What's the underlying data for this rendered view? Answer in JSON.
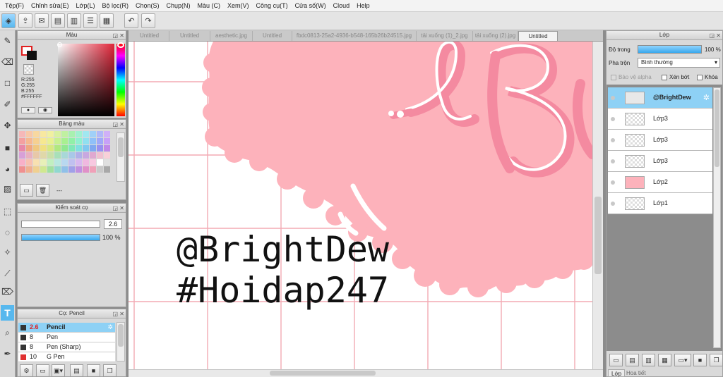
{
  "menu": [
    "Tệp(F)",
    "Chỉnh sửa(E)",
    "Lớp(L)",
    "Bộ lọc(R)",
    "Chọn(S)",
    "Chụp(N)",
    "Màu (C)",
    "Xem(V)",
    "Công cụ(T)",
    "Cửa số(W)",
    "Cloud",
    "Help"
  ],
  "color_panel": {
    "title": "Màu",
    "r": "R:255",
    "g": "G:255",
    "b": "B:255",
    "hex": "#FFFFFF"
  },
  "palette_panel": {
    "title": "Bảng màu",
    "more": "---"
  },
  "brush_control": {
    "title": "Kiểm soát cọ",
    "size_value": "2.6",
    "size_fraction": 0.95,
    "opacity_label": "100 %",
    "opacity_fraction": 1.0
  },
  "brush_panel": {
    "title": "Cọ: Pencil",
    "items": [
      {
        "size": "2.6",
        "name": "Pencil",
        "color": "#333333"
      },
      {
        "size": "8",
        "name": "Pen",
        "color": "#333333"
      },
      {
        "size": "8",
        "name": "Pen (Sharp)",
        "color": "#333333"
      },
      {
        "size": "10",
        "name": "G Pen",
        "color": "#e03030"
      }
    ]
  },
  "tabs": [
    "Untitled",
    "Untitled",
    "aesthetic.jpg",
    "Untitled",
    "fbdc0813-25a2-4936-b548-165b26b24515.jpg",
    "tải xuống (1)_2.jpg",
    "tải xuống (2).jpg",
    "Untitled"
  ],
  "canvas": {
    "line1": "@BrightDew",
    "line2": "#Hoidap247",
    "letters": "Br"
  },
  "layer_panel": {
    "title": "Lớp",
    "opacity_label": "Độ trong",
    "opacity_value": "100 %",
    "opacity_fraction": 1.0,
    "blend_label": "Pha trộn",
    "blend_value": "Bình thường",
    "protect_alpha": "Bảo vệ alpha",
    "clipping": "Xén bớt",
    "lock": "Khóa",
    "layers": [
      {
        "name": "@BrightDew",
        "selected": true
      },
      {
        "name": "Lớp3",
        "selected": false
      },
      {
        "name": "Lớp3",
        "selected": false
      },
      {
        "name": "Lớp3",
        "selected": false
      },
      {
        "name": "Lớp2",
        "selected": false
      },
      {
        "name": "Lớp1",
        "selected": false
      }
    ],
    "bottom_tabs": [
      "Lớp",
      "Hoa tiết"
    ]
  },
  "colors": {
    "accent": "#58b8ee",
    "pink": "#fdb2bb",
    "pink_dark": "#f48aa0"
  },
  "swatch_colors": [
    "#f6b8b8",
    "#f8c8a8",
    "#f8d8a0",
    "#f8e8a0",
    "#f0f0a0",
    "#d8f0a0",
    "#c0f0a0",
    "#a8f0b0",
    "#a0f0d0",
    "#a0e8f0",
    "#a0d0f8",
    "#b0b8f8",
    "#d0b0f8",
    "#f4a0a0",
    "#f6b890",
    "#f6d090",
    "#f6e890",
    "#e8f090",
    "#c8f090",
    "#a8f090",
    "#90f0a8",
    "#90f0d0",
    "#90e0f0",
    "#90c0f8",
    "#a0a8f8",
    "#c8a0f8",
    "#e888a8",
    "#f0a880",
    "#f0c880",
    "#f0e080",
    "#d8e880",
    "#b0e880",
    "#90e890",
    "#80e8b8",
    "#80e0e0",
    "#80c8f0",
    "#80a8f0",
    "#9890f0",
    "#c088e8",
    "#d8a0d8",
    "#e8b0c0",
    "#e8c8a8",
    "#e0d8a8",
    "#c8e0a8",
    "#a8e0b8",
    "#a8d8d8",
    "#a8c8e8",
    "#b0b0e8",
    "#c8a8e0",
    "#e0a8d0",
    "#f0c0d0",
    "#f8d0d8",
    "#f8b0c8",
    "#f8c0b0",
    "#f8e0b0",
    "#e8f0b8",
    "#c0f0c0",
    "#b8e8e0",
    "#b8d8f0",
    "#c0c0f0",
    "#d8b8f0",
    "#f0b8e0",
    "#f8c8e0",
    "#ffffff",
    "#e0e0e0",
    "#f09090",
    "#f0b090",
    "#f0d090",
    "#d0e890",
    "#a0e0a0",
    "#90d8d0",
    "#90c0e8",
    "#a0a0e8",
    "#c090e0",
    "#e090c8",
    "#f0a0b8",
    "#c8c8c8",
    "#a8a8a8"
  ]
}
